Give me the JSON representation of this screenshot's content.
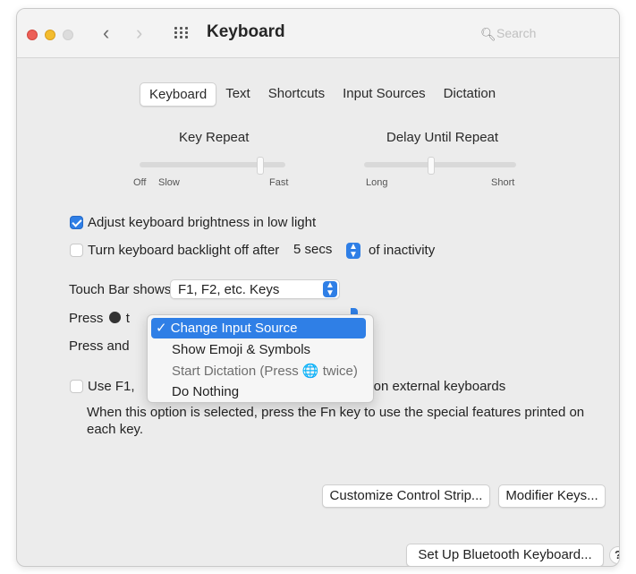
{
  "window": {
    "title": "Keyboard",
    "search_placeholder": "Search",
    "nav_back": "‹",
    "nav_forward": "›"
  },
  "tabs": [
    {
      "label": "Keyboard",
      "active": true
    },
    {
      "label": "Text",
      "active": false
    },
    {
      "label": "Shortcuts",
      "active": false
    },
    {
      "label": "Input Sources",
      "active": false
    },
    {
      "label": "Dictation",
      "active": false
    }
  ],
  "key_repeat": {
    "label": "Key Repeat",
    "tick_left_off": "Off",
    "tick_left_slow": "Slow",
    "tick_right": "Fast"
  },
  "delay_repeat": {
    "label": "Delay Until Repeat",
    "tick_left": "Long",
    "tick_right": "Short"
  },
  "options": {
    "adjust_brightness": {
      "label": "Adjust keyboard brightness in low light",
      "checked": true
    },
    "backlight_off": {
      "label": "Turn keyboard backlight off after",
      "value": "5 secs",
      "suffix": "of inactivity",
      "checked": false
    }
  },
  "touch_bar": {
    "label": "Touch Bar shows",
    "value": "F1, F2, etc. Keys"
  },
  "press_globe": {
    "label_prefix": "Press",
    "label_cut": "t"
  },
  "press_and": {
    "label": "Press and"
  },
  "globe_menu": {
    "items": [
      {
        "label": "Change Input Source",
        "check": "✓",
        "selected": true
      },
      {
        "label": "Show Emoji & Symbols",
        "selected": false
      },
      {
        "label": "Start Dictation (Press 🌐 twice)",
        "selected": false,
        "disabled": true
      },
      {
        "label": "Do Nothing",
        "selected": false
      }
    ]
  },
  "use_fkeys": {
    "label_start": "Use F1,",
    "label_end": "s on external keyboards",
    "description": "When this option is selected, press the Fn key to use the special features printed on each key."
  },
  "buttons": {
    "customize_control_strip": "Customize Control Strip...",
    "modifier_keys": "Modifier Keys...",
    "bluetooth_keyboard": "Set Up Bluetooth Keyboard...",
    "help": "?"
  }
}
